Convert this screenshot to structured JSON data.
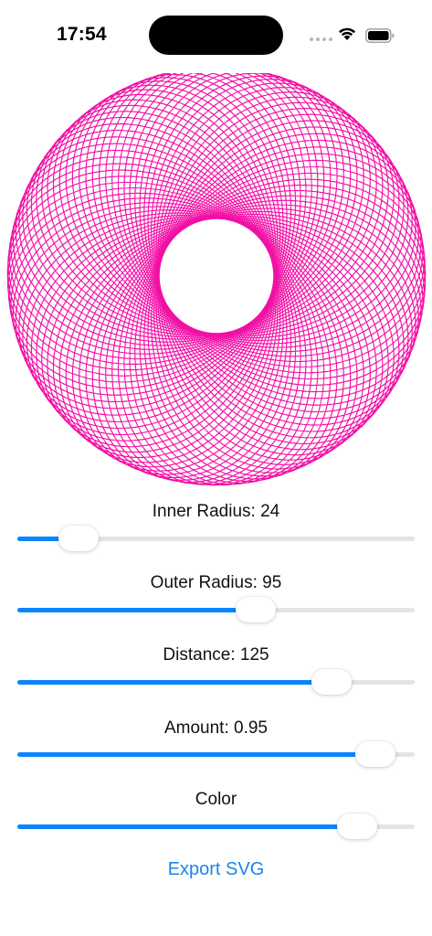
{
  "status_bar": {
    "time": "17:54"
  },
  "spirograph": {
    "color": "#f20fa5",
    "inner_radius": 24,
    "outer_radius": 95,
    "distance": 125,
    "amount": 0.95
  },
  "controls": [
    {
      "label": "Inner Radius: 24",
      "value": 0.155,
      "name": "inner-radius"
    },
    {
      "label": "Outer Radius: 95",
      "value": 0.6,
      "name": "outer-radius"
    },
    {
      "label": "Distance: 125",
      "value": 0.79,
      "name": "distance"
    },
    {
      "label": "Amount: 0.95",
      "value": 0.9,
      "name": "amount"
    },
    {
      "label": "Color",
      "value": 0.855,
      "name": "color"
    }
  ],
  "export": {
    "label": "Export SVG"
  },
  "colors": {
    "accent": "#0a84ff",
    "link": "#1a84ea",
    "track": "#e4e4e6"
  }
}
